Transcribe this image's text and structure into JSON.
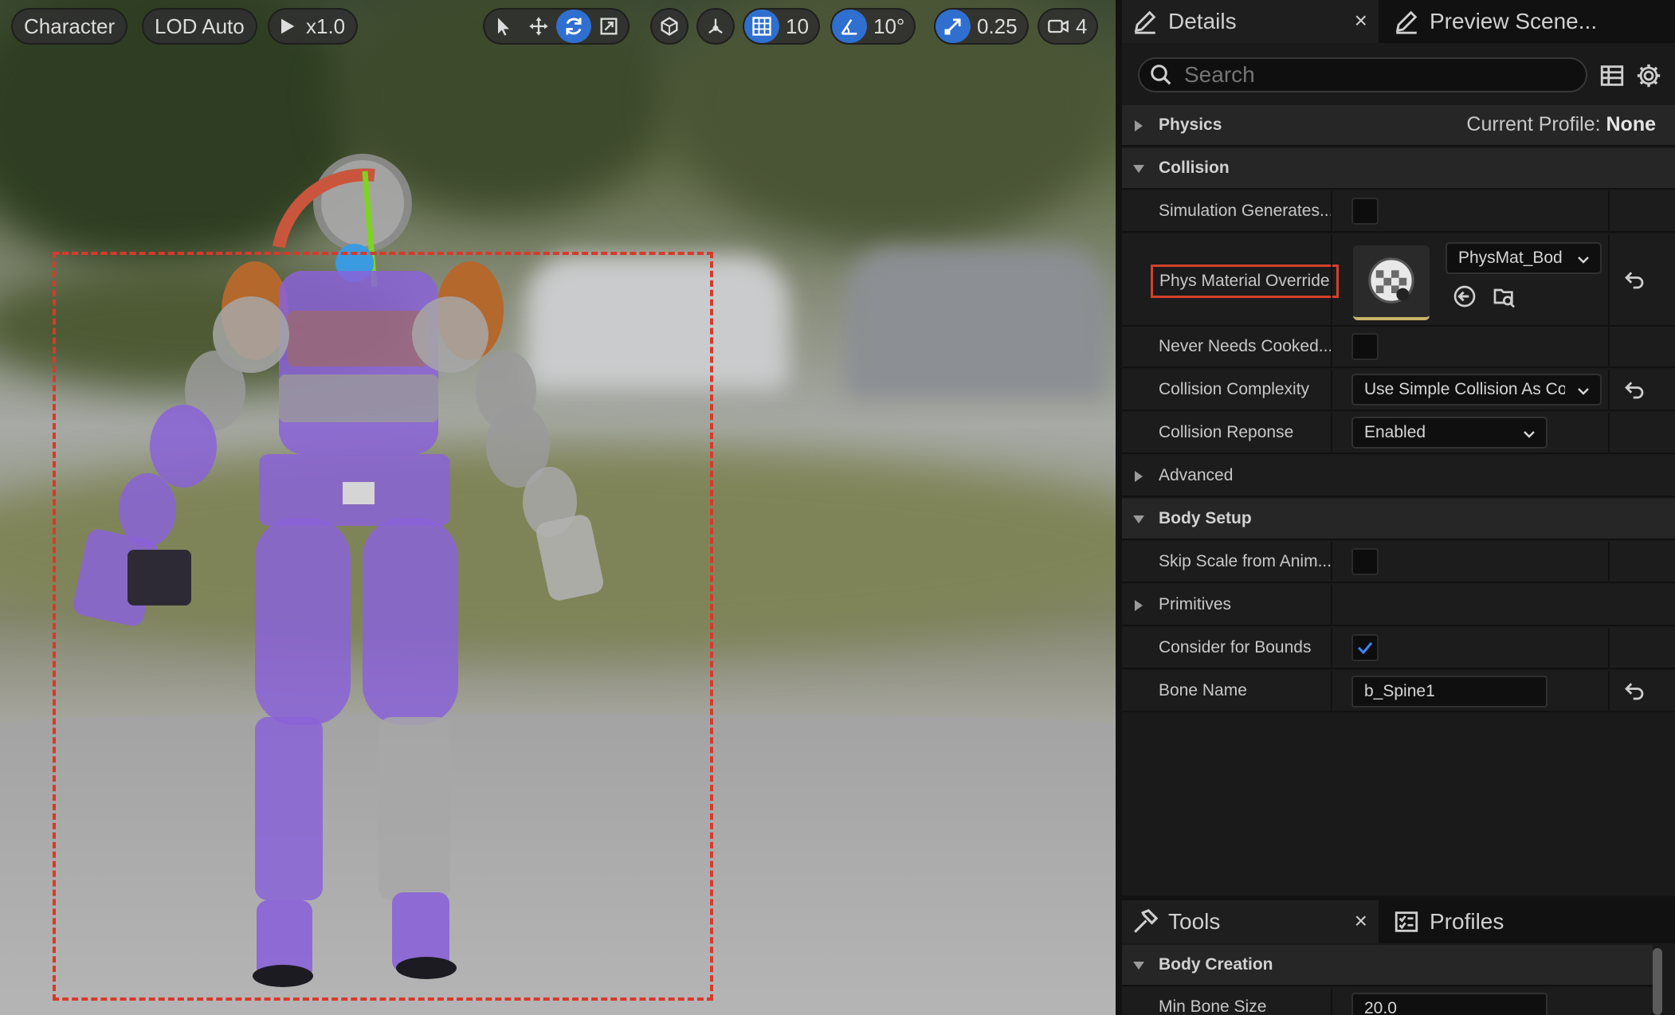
{
  "viewport": {
    "toolbar": {
      "character_label": "Character",
      "lod_label": "LOD Auto",
      "play_speed": "x1.0",
      "grid_snap_value": "10",
      "rotation_snap_value": "10°",
      "scale_snap_value": "0.25",
      "camera_speed_value": "4"
    },
    "colors": {
      "accent": "#2f6fcf",
      "selection_outline": "#d8392c",
      "body_highlight": "#8a63d8"
    }
  },
  "details_panel": {
    "tab_title": "Details",
    "second_tab_title": "Preview Scene...",
    "search_placeholder": "Search",
    "physics": {
      "label": "Physics",
      "profile_caption": "Current Profile:",
      "profile_value": "None"
    },
    "collision": {
      "label": "Collision",
      "simulation_generates_label": "Simulation Generates...",
      "phys_material_override_label": "Phys Material Override",
      "phys_material_value": "PhysMat_Bod",
      "never_needs_cooked_label": "Never Needs Cooked...",
      "collision_complexity_label": "Collision Complexity",
      "collision_complexity_value": "Use Simple Collision As Complex",
      "collision_response_label": "Collision Reponse",
      "collision_response_value": "Enabled",
      "advanced_label": "Advanced"
    },
    "body_setup": {
      "label": "Body Setup",
      "skip_scale_label": "Skip Scale from Anim...",
      "primitives_label": "Primitives",
      "consider_bounds_label": "Consider for Bounds",
      "consider_bounds_checked": true,
      "bone_name_label": "Bone Name",
      "bone_name_value": "b_Spine1"
    }
  },
  "tools_panel": {
    "tab_title": "Tools",
    "second_tab_title": "Profiles",
    "body_creation_label": "Body Creation",
    "min_bone_size_label": "Min Bone Size",
    "min_bone_size_value": "20.0"
  }
}
